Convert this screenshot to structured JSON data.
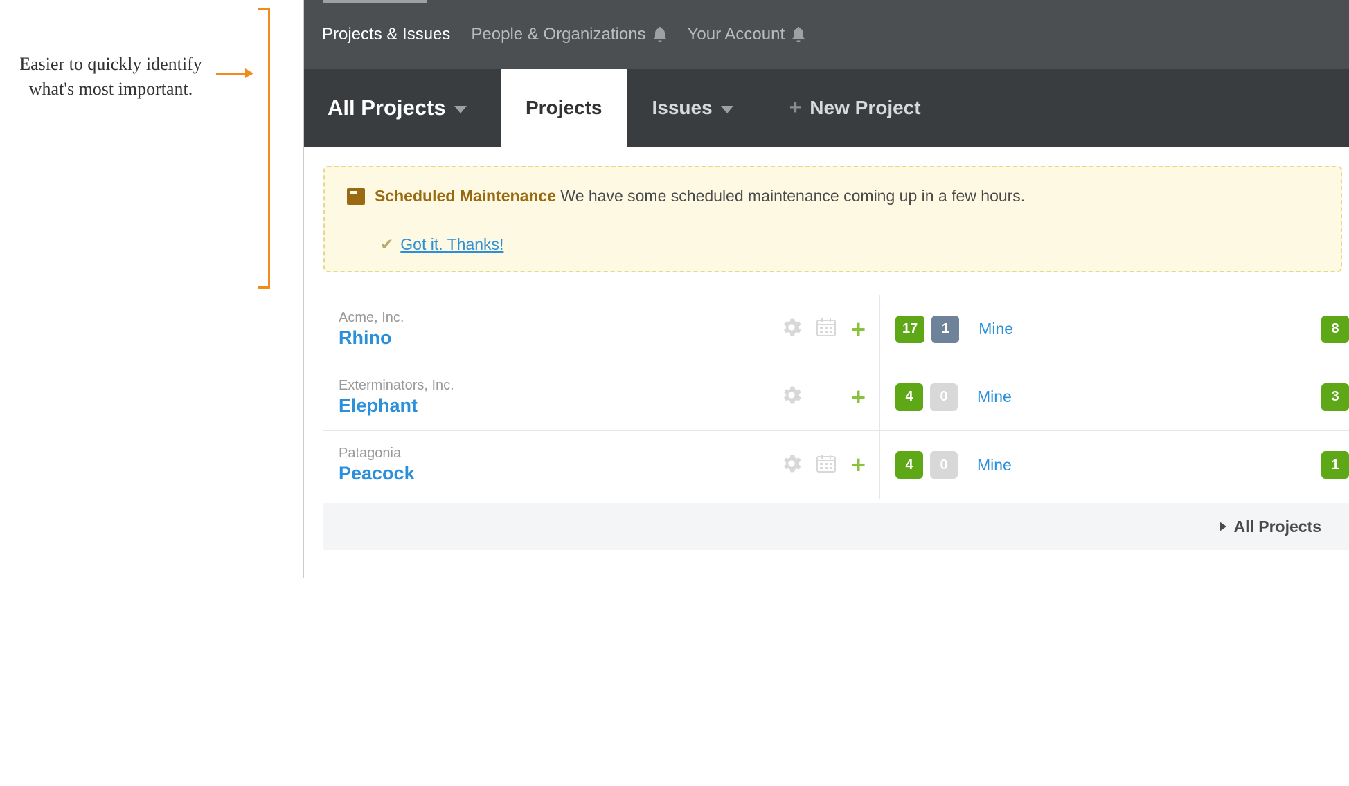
{
  "annotation": {
    "text": "Easier to quickly identify what's most important."
  },
  "topnav": {
    "items": [
      {
        "label": "Projects & Issues",
        "active": true,
        "bell": false
      },
      {
        "label": "People & Organizations",
        "active": false,
        "bell": true
      },
      {
        "label": "Your Account",
        "active": false,
        "bell": true
      }
    ]
  },
  "subheader": {
    "filter_label": "All Projects",
    "tabs": [
      {
        "label": "Projects",
        "active": true
      },
      {
        "label": "Issues",
        "dropdown": true
      },
      {
        "label": "New Project",
        "plus": true
      }
    ]
  },
  "notice": {
    "title": "Scheduled Maintenance",
    "body": "We have some scheduled maintenance coming up in a few hours.",
    "dismiss": "Got it. Thanks!"
  },
  "projects": [
    {
      "company": "Acme, Inc.",
      "name": "Rhino",
      "show_calendar": true,
      "count_green": "17",
      "count_secondary": "1",
      "secondary_style": "slate",
      "mine_label": "Mine",
      "trailing": "8"
    },
    {
      "company": "Exterminators, Inc.",
      "name": "Elephant",
      "show_calendar": false,
      "count_green": "4",
      "count_secondary": "0",
      "secondary_style": "grey",
      "mine_label": "Mine",
      "trailing": "3"
    },
    {
      "company": "Patagonia",
      "name": "Peacock",
      "show_calendar": true,
      "count_green": "4",
      "count_secondary": "0",
      "secondary_style": "grey",
      "mine_label": "Mine",
      "trailing": "1"
    }
  ],
  "footer": {
    "label": "All Projects"
  }
}
